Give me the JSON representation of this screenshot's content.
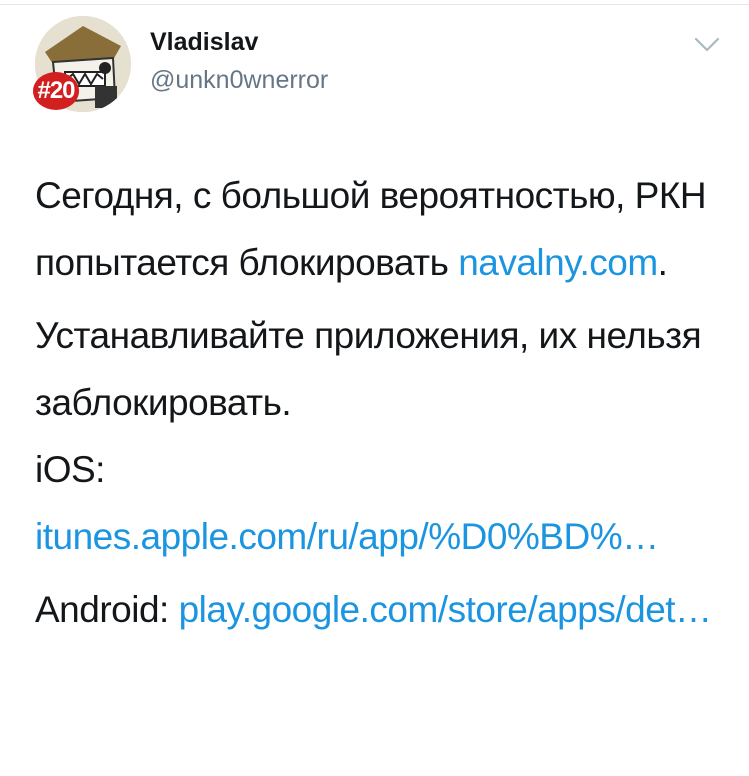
{
  "tweet": {
    "author_name": "Vladislav",
    "author_handle": "@unkn0wnerror",
    "avatar_badge": "#20",
    "para1_text": "Сегодня, с большой вероятностью, РКН попытается блокировать ",
    "para1_link": "navalny.com",
    "para1_end": ".",
    "para2_line1": "Устанавливайте приложения, их нельзя заблокировать.",
    "ios_label": "iOS: ",
    "ios_link": "itunes.apple.com/ru/app/%D0%BD%…",
    "android_label": "Android: ",
    "android_link": "play.google.com/store/apps/det…"
  },
  "colors": {
    "link": "#1b95e0",
    "handle": "#657786",
    "badge": "#d21f1f"
  },
  "icons": {
    "menu": "chevron-down-icon"
  }
}
